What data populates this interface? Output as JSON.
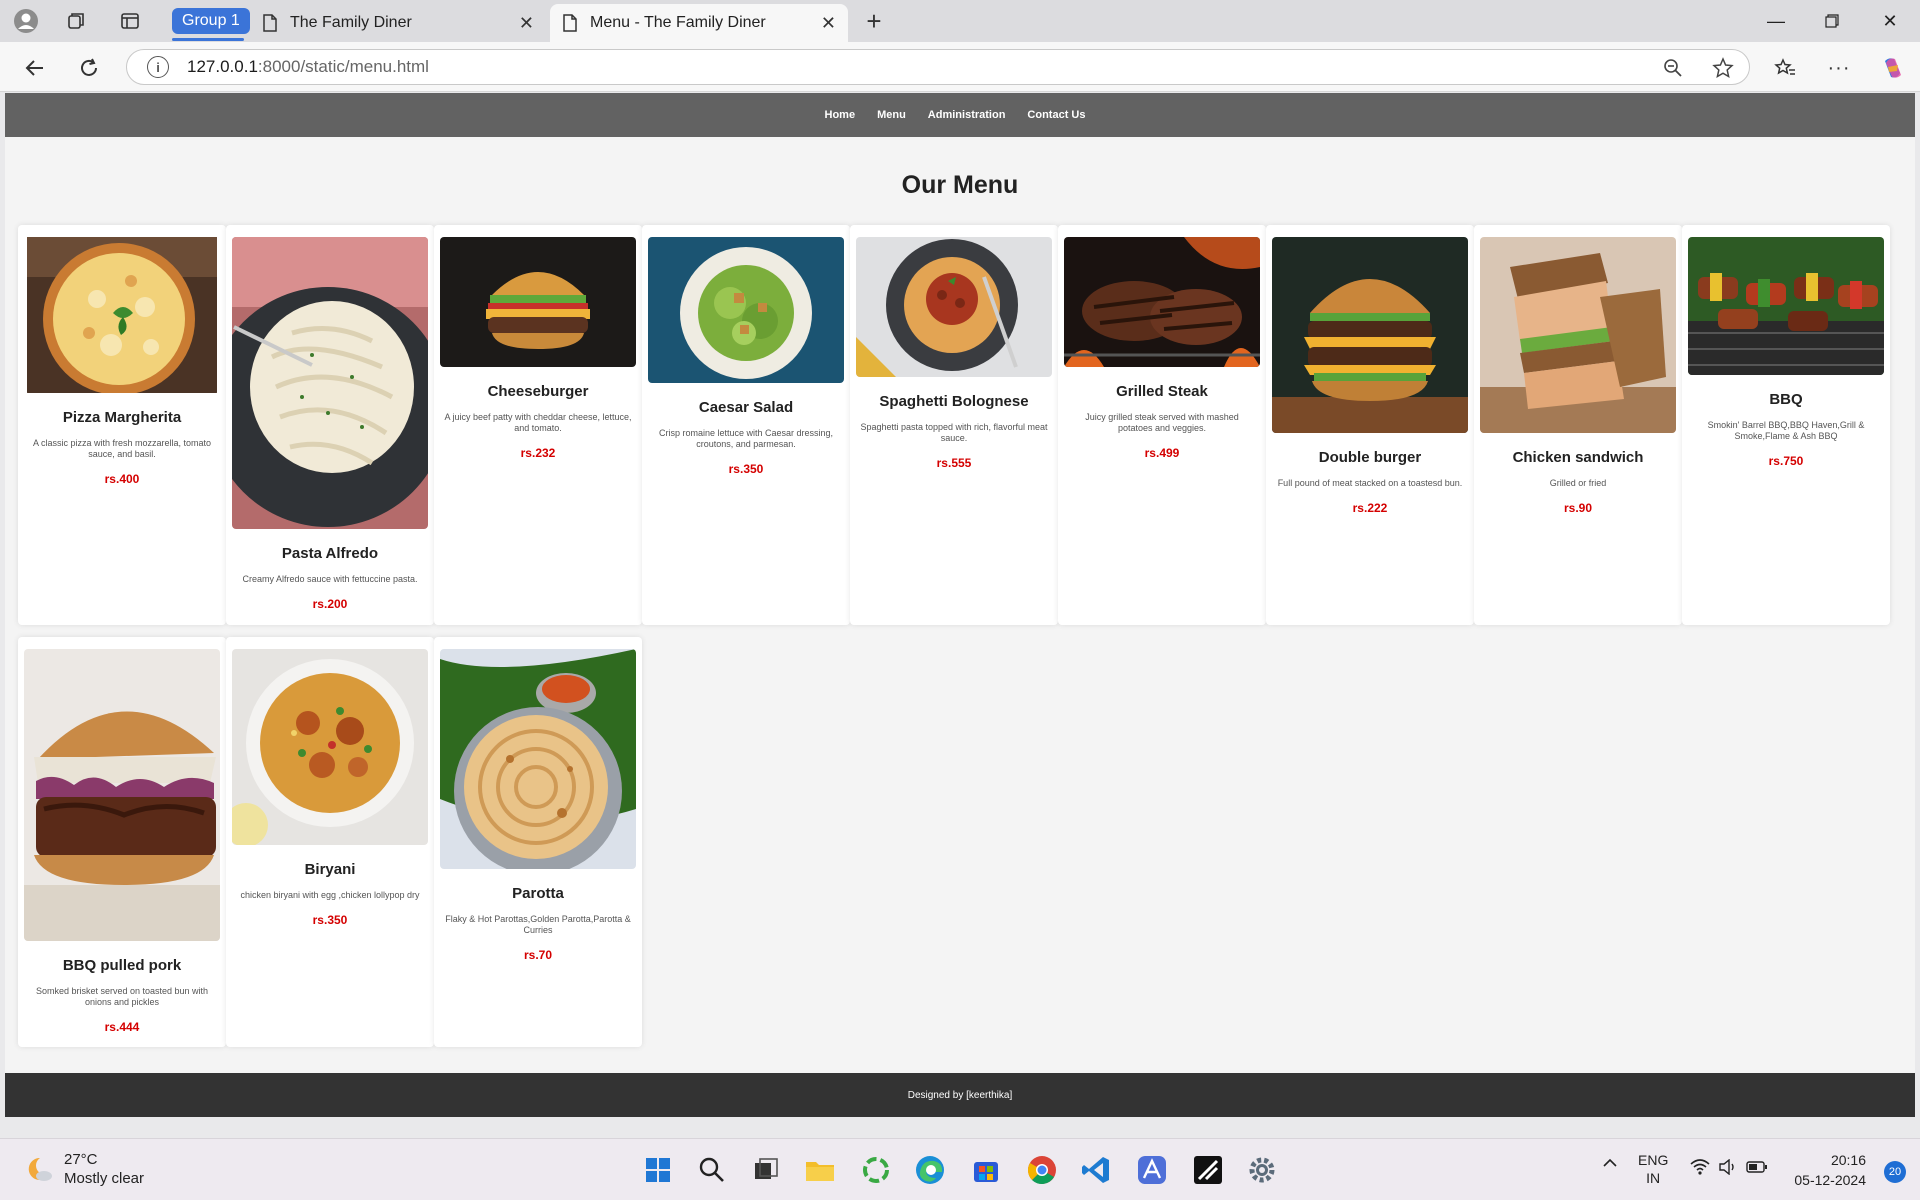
{
  "browser": {
    "group_label": "Group 1",
    "tabs": [
      {
        "title": "The Family Diner",
        "active": false
      },
      {
        "title": "Menu - The Family Diner",
        "active": true
      }
    ],
    "url_host": "127.0.0.1",
    "url_rest": ":8000/static/menu.html"
  },
  "site": {
    "nav": [
      "Home",
      "Menu",
      "Administration",
      "Contact Us"
    ],
    "heading": "Our Menu",
    "footer": "Designed by [keerthika]"
  },
  "menu_items": [
    {
      "name": "Pizza Margherita",
      "desc": "A classic pizza with fresh mozzarella, tomato sauce, and basil.",
      "price": "rs.400",
      "image": "pizza"
    },
    {
      "name": "Pasta Alfredo",
      "desc": "Creamy Alfredo sauce with fettuccine pasta.",
      "price": "rs.200",
      "image": "pasta"
    },
    {
      "name": "Cheeseburger",
      "desc": "A juicy beef patty with cheddar cheese, lettuce, and tomato.",
      "price": "rs.232",
      "image": "burger"
    },
    {
      "name": "Caesar Salad",
      "desc": "Crisp romaine lettuce with Caesar dressing, croutons, and parmesan.",
      "price": "rs.350",
      "image": "salad"
    },
    {
      "name": "Spaghetti Bolognese",
      "desc": "Spaghetti pasta topped with rich, flavorful meat sauce.",
      "price": "rs.555",
      "image": "spaghetti"
    },
    {
      "name": "Grilled Steak",
      "desc": "Juicy grilled steak served with mashed potatoes and veggies.",
      "price": "rs.499",
      "image": "steak"
    },
    {
      "name": "Double burger",
      "desc": "Full pound of meat stacked on a toastesd bun.",
      "price": "rs.222",
      "image": "double-burger"
    },
    {
      "name": "Chicken sandwich",
      "desc": "Grilled or fried",
      "price": "rs.90",
      "image": "sandwich"
    },
    {
      "name": "BBQ",
      "desc": "Smokin' Barrel BBQ,BBQ Haven,Grill & Smoke,Flame & Ash BBQ",
      "price": "rs.750",
      "image": "bbq"
    },
    {
      "name": "BBQ pulled pork",
      "desc": "Somked brisket served on toasted bun with onions and pickles",
      "price": "rs.444",
      "image": "pulled-pork"
    },
    {
      "name": "Biryani",
      "desc": "chicken biryani with egg ,chicken lollypop dry",
      "price": "rs.350",
      "image": "biryani"
    },
    {
      "name": "Parotta",
      "desc": "Flaky & Hot Parottas,Golden Parotta,Parotta & Curries",
      "price": "rs.70",
      "image": "parotta"
    }
  ],
  "taskbar": {
    "temperature": "27°C",
    "weather": "Mostly clear",
    "lang_top": "ENG",
    "lang_bottom": "IN",
    "time": "20:16",
    "date": "05-12-2024",
    "notifications": "20"
  },
  "colors": {
    "price": "#d40000",
    "header": "#626262",
    "footer": "#333333",
    "group": "#3b74d8"
  }
}
